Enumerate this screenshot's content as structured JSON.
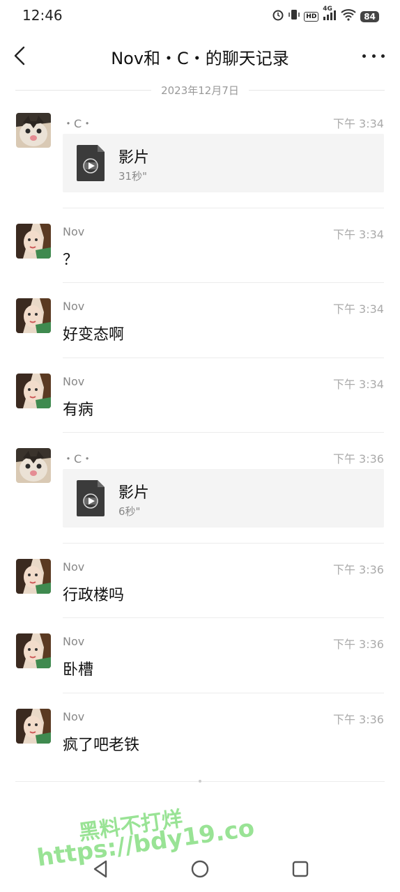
{
  "status_bar": {
    "time": "12:46",
    "network": "4G",
    "hd": "HD",
    "battery": "84",
    "icons": [
      "alarm-icon",
      "vibrate-icon",
      "hd-icon",
      "signal-icon",
      "wifi-icon",
      "battery-icon"
    ]
  },
  "header": {
    "title": "Nov和・C・的聊天记录",
    "back_icon": "chevron-left-icon",
    "more_icon": "more-dots-icon"
  },
  "date_divider": "2023年12月7日",
  "messages": [
    {
      "sender": "・C・",
      "time": "下午 3:34",
      "type": "video",
      "card_title": "影片",
      "card_sub": "31秒\"",
      "avatar": "cat-avatar"
    },
    {
      "sender": "Nov",
      "time": "下午 3:34",
      "type": "text",
      "text": "？",
      "avatar": "girl-avatar"
    },
    {
      "sender": "Nov",
      "time": "下午 3:34",
      "type": "text",
      "text": "好变态啊",
      "avatar": "girl-avatar"
    },
    {
      "sender": "Nov",
      "time": "下午 3:34",
      "type": "text",
      "text": "有病",
      "avatar": "girl-avatar"
    },
    {
      "sender": "・C・",
      "time": "下午 3:36",
      "type": "video",
      "card_title": "影片",
      "card_sub": "6秒\"",
      "avatar": "cat-avatar"
    },
    {
      "sender": "Nov",
      "time": "下午 3:36",
      "type": "text",
      "text": "行政楼吗",
      "avatar": "girl-avatar"
    },
    {
      "sender": "Nov",
      "time": "下午 3:36",
      "type": "text",
      "text": "卧槽",
      "avatar": "girl-avatar"
    },
    {
      "sender": "Nov",
      "time": "下午 3:36",
      "type": "text",
      "text": "疯了吧老铁",
      "avatar": "girl-avatar"
    }
  ],
  "watermark": {
    "line1": "黑料不打烊",
    "line2": "https://bdy19.co"
  },
  "nav_bar": {
    "icons": [
      "nav-back-icon",
      "nav-home-icon",
      "nav-recent-icon"
    ]
  },
  "colors": {
    "background": "#ffffff",
    "card_bg": "#f4f4f4",
    "meta_text": "#888888",
    "watermark": "#8ee08a"
  }
}
